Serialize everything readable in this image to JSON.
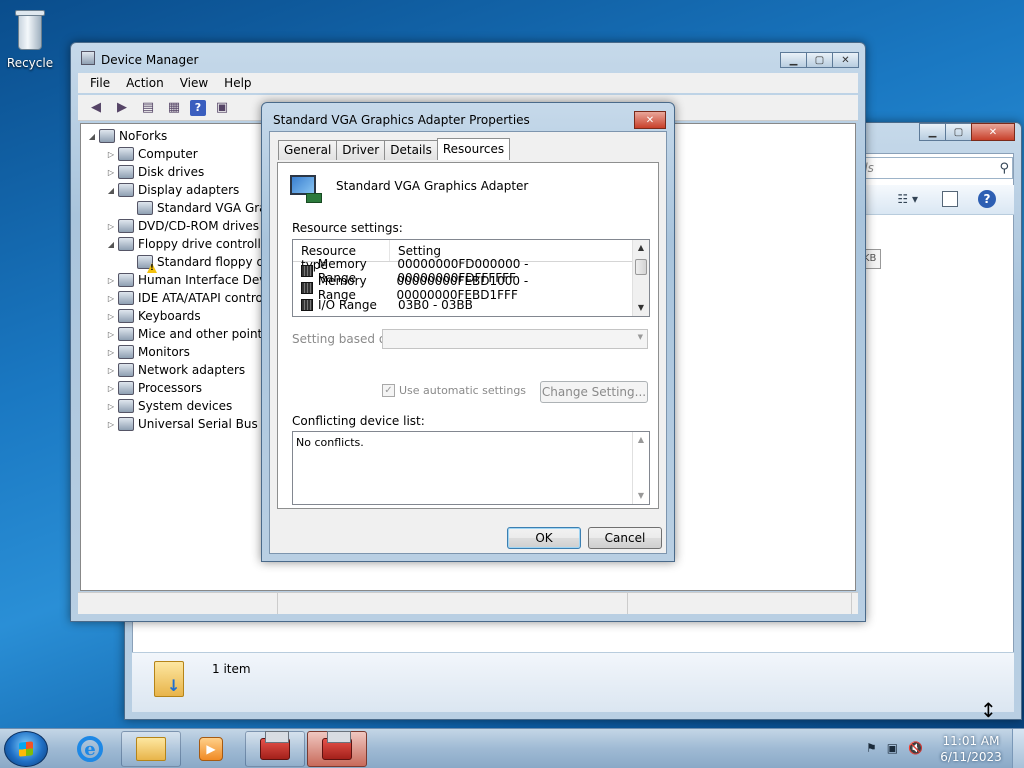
{
  "desktop": {
    "recycle_label": "Recycle"
  },
  "explorer": {
    "search_placeholder": "ds",
    "size_fragment": "KB",
    "status_text": "1 item"
  },
  "device_manager": {
    "title": "Device Manager",
    "menu": [
      "File",
      "Action",
      "View",
      "Help"
    ],
    "tree": [
      {
        "label": "NoForks",
        "level": 0,
        "arrow": "◢"
      },
      {
        "label": "Computer",
        "level": 1,
        "arrow": "▷"
      },
      {
        "label": "Disk drives",
        "level": 1,
        "arrow": "▷"
      },
      {
        "label": "Display adapters",
        "level": 1,
        "arrow": "◢"
      },
      {
        "label": "Standard VGA Grap",
        "level": 2,
        "arrow": ""
      },
      {
        "label": "DVD/CD-ROM drives",
        "level": 1,
        "arrow": "▷"
      },
      {
        "label": "Floppy drive controller",
        "level": 1,
        "arrow": "◢"
      },
      {
        "label": "Standard floppy dis",
        "level": 2,
        "arrow": "",
        "warn": true
      },
      {
        "label": "Human Interface Devic",
        "level": 1,
        "arrow": "▷"
      },
      {
        "label": "IDE ATA/ATAPI contro",
        "level": 1,
        "arrow": "▷"
      },
      {
        "label": "Keyboards",
        "level": 1,
        "arrow": "▷"
      },
      {
        "label": "Mice and other pointin",
        "level": 1,
        "arrow": "▷"
      },
      {
        "label": "Monitors",
        "level": 1,
        "arrow": "▷"
      },
      {
        "label": "Network adapters",
        "level": 1,
        "arrow": "▷"
      },
      {
        "label": "Processors",
        "level": 1,
        "arrow": "▷"
      },
      {
        "label": "System devices",
        "level": 1,
        "arrow": "▷"
      },
      {
        "label": "Universal Serial Bus co",
        "level": 1,
        "arrow": "▷"
      }
    ]
  },
  "dialog": {
    "title": "Standard VGA Graphics Adapter Properties",
    "close_glyph": "✕",
    "tabs": [
      "General",
      "Driver",
      "Details",
      "Resources"
    ],
    "active_tab": "Resources",
    "device_name": "Standard VGA Graphics Adapter",
    "resource_settings_label": "Resource settings:",
    "columns": [
      "Resource type",
      "Setting"
    ],
    "resources": [
      {
        "type": "Memory Range",
        "setting": "00000000FD000000 - 00000000FDFFFFFF"
      },
      {
        "type": "Memory Range",
        "setting": "00000000FEBD1000 - 00000000FEBD1FFF"
      },
      {
        "type": "I/O Range",
        "setting": "03B0 - 03BB"
      }
    ],
    "setting_based_on_label": "Setting based on:",
    "use_auto_label": "Use automatic settings",
    "change_setting_label": "Change Setting...",
    "conflict_label": "Conflicting device list:",
    "conflict_text": "No conflicts.",
    "ok_label": "OK",
    "cancel_label": "Cancel"
  },
  "taskbar": {
    "time": "11:01 AM",
    "date": "6/11/2023"
  }
}
